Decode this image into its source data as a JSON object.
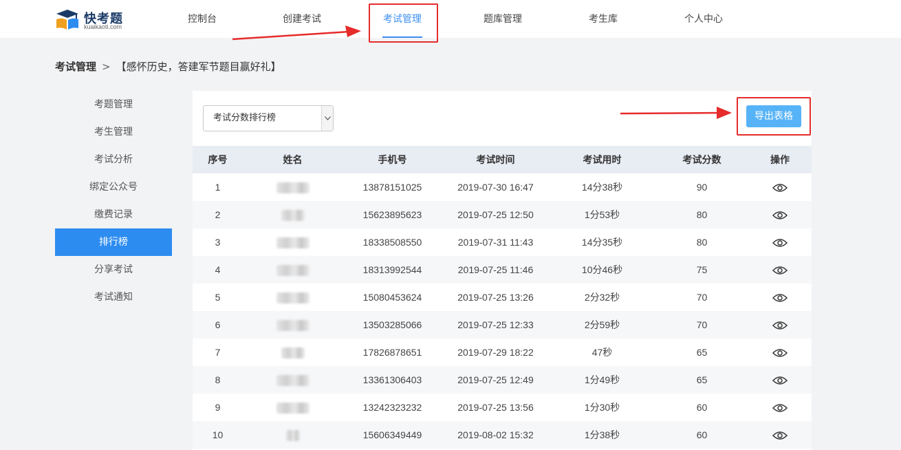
{
  "header": {
    "brand": "快考题",
    "domain": "kuaikaoti.com",
    "nav": [
      {
        "label": "控制台"
      },
      {
        "label": "创建考试"
      },
      {
        "label": "考试管理"
      },
      {
        "label": "题库管理"
      },
      {
        "label": "考生库"
      },
      {
        "label": "个人中心"
      }
    ]
  },
  "breadcrumb": {
    "root": "考试管理",
    "separator": ">",
    "current": "【感怀历史，答建军节题目赢好礼】"
  },
  "sidebar": {
    "items": [
      {
        "label": "考题管理"
      },
      {
        "label": "考生管理"
      },
      {
        "label": "考试分析"
      },
      {
        "label": "绑定公众号"
      },
      {
        "label": "缴费记录"
      },
      {
        "label": "排行榜"
      },
      {
        "label": "分享考试"
      },
      {
        "label": "考试通知"
      }
    ]
  },
  "main": {
    "selector_value": "考试分数排行榜",
    "export_label": "导出表格",
    "columns": [
      "序号",
      "姓名",
      "手机号",
      "考试时间",
      "考试用时",
      "考试分数",
      "操作"
    ],
    "rows": [
      {
        "idx": "1",
        "phone": "13878151025",
        "time": "2019-07-30 16:47",
        "duration": "14分38秒",
        "score": "90"
      },
      {
        "idx": "2",
        "phone": "15623895623",
        "time": "2019-07-25 12:50",
        "duration": "1分53秒",
        "score": "80"
      },
      {
        "idx": "3",
        "phone": "18338508550",
        "time": "2019-07-31 11:43",
        "duration": "14分35秒",
        "score": "80"
      },
      {
        "idx": "4",
        "phone": "18313992544",
        "time": "2019-07-25 11:46",
        "duration": "10分46秒",
        "score": "75"
      },
      {
        "idx": "5",
        "phone": "15080453624",
        "time": "2019-07-25 13:26",
        "duration": "2分32秒",
        "score": "70"
      },
      {
        "idx": "6",
        "phone": "13503285066",
        "time": "2019-07-25 12:33",
        "duration": "2分59秒",
        "score": "70"
      },
      {
        "idx": "7",
        "phone": "17826878651",
        "time": "2019-07-29 18:22",
        "duration": "47秒",
        "score": "65"
      },
      {
        "idx": "8",
        "phone": "13361306403",
        "time": "2019-07-25 12:49",
        "duration": "1分49秒",
        "score": "65"
      },
      {
        "idx": "9",
        "phone": "13242323232",
        "time": "2019-07-25 13:56",
        "duration": "1分30秒",
        "score": "60"
      },
      {
        "idx": "10",
        "phone": "15606349449",
        "time": "2019-08-02 15:32",
        "duration": "1分38秒",
        "score": "60"
      }
    ]
  },
  "colors": {
    "accent": "#2d8cf0",
    "export_button": "#57b3f7",
    "annotation": "#e62b2b"
  },
  "icons": {
    "view": "eye-icon",
    "dropdown": "chevron-down-icon",
    "logo": "book-graduation-cap-icon"
  }
}
